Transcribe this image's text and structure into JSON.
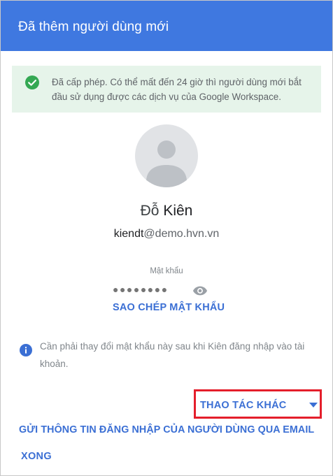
{
  "dialog": {
    "title": "Đã thêm người dùng mới"
  },
  "alert": {
    "icon": "check-circle-icon",
    "color": "#34a853",
    "background": "#e6f4ea",
    "text": "Đã cấp phép. Có thể mất đến 24 giờ thì người dùng mới bắt đầu sử dụng được các dịch vụ của Google Workspace."
  },
  "user": {
    "avatar_icon": "avatar-placeholder-icon",
    "last_name": "Đỗ",
    "first_name": "Kiên",
    "email_local": "kiendt",
    "email_domain": "@demo.hvn.vn"
  },
  "password": {
    "label": "Mật khẩu",
    "masked_value": "●●●●●●●●",
    "toggle_icon": "eye-icon",
    "copy_label": "SAO CHÉP MẬT KHẨU"
  },
  "info": {
    "icon": "info-icon",
    "text": "Cần phải thay đổi mật khẩu này sau khi Kiên đăng nhập vào tài khoản."
  },
  "actions": {
    "more_label": "THAO TÁC KHÁC",
    "more_icon": "caret-down-icon",
    "send_email_label": "GỬI THÔNG TIN ĐĂNG NHẬP CỦA NGƯỜI DÙNG QUA EMAIL",
    "done_label": "XONG"
  },
  "colors": {
    "header": "#3f78e0",
    "accent": "#3b6fd4",
    "highlight_border": "#e41e2b"
  }
}
